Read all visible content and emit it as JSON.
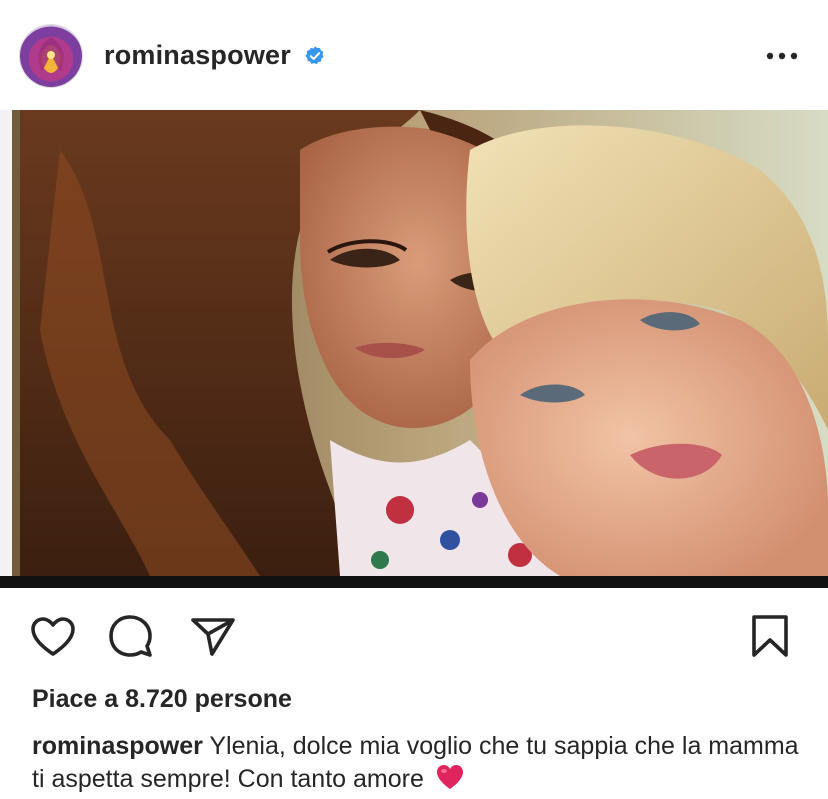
{
  "post": {
    "username": "rominaspower",
    "verified": true,
    "more_icon": "more-horizontal-icon",
    "image_alt": "photo"
  },
  "actions": {
    "like_icon": "heart-outline-icon",
    "comment_icon": "comment-bubble-icon",
    "share_icon": "paper-plane-icon",
    "save_icon": "bookmark-outline-icon"
  },
  "likes": {
    "prefix": "Piace a",
    "count": "8.720",
    "suffix": "persone"
  },
  "caption": {
    "username": "rominaspower",
    "text": "Ylenia, dolce mia voglio che tu sappia che la mamma ti aspetta sempre! Con tanto amore"
  },
  "colors": {
    "text": "#262626",
    "verified": "#3897f0",
    "heart_emoji": "#e0245e"
  }
}
